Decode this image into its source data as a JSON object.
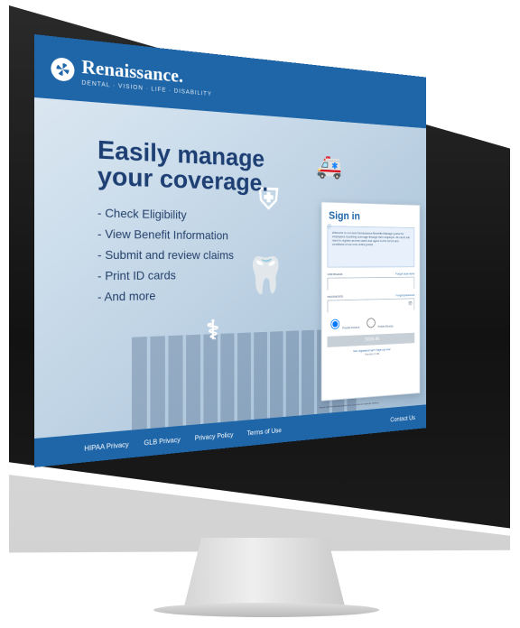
{
  "brand": {
    "name": "Renaissance.",
    "tagline": "DENTAL · VISION · LIFE · DISABILITY"
  },
  "hero": {
    "headline": "Easily manage your coverage.",
    "bullets": [
      "Check Eligibility",
      "View Benefit Information",
      "Submit and review claims",
      "Print ID cards",
      "And more"
    ]
  },
  "signin": {
    "title": "Sign in",
    "notice": "Welcome to our new Renaissance Benefits Manager portal for employees receiving coverage through their employer. All users will need to register as new users and agree to the terms and conditions of our new online portal.",
    "username_label": "USERNAME",
    "forgot_username": "Forgot username",
    "password_label": "PASSWORD",
    "forgot_password": "Forgot password",
    "radio_options": [
      "Private Device",
      "Public Device"
    ],
    "signin_button": "SIGN IN",
    "register_link": "Not registered yet? Sign up now",
    "version": "Version 2.06"
  },
  "footer": {
    "links": [
      "HIPAA Privacy",
      "GLB Privacy",
      "Privacy Policy",
      "Terms of Use"
    ],
    "contact": "Contact Us",
    "note": "Please visit RenBenefitsAdmin.com if you are an employer seeking"
  },
  "colors": {
    "brand_blue": "#1f66a8",
    "hero_text": "#1d3f73"
  }
}
